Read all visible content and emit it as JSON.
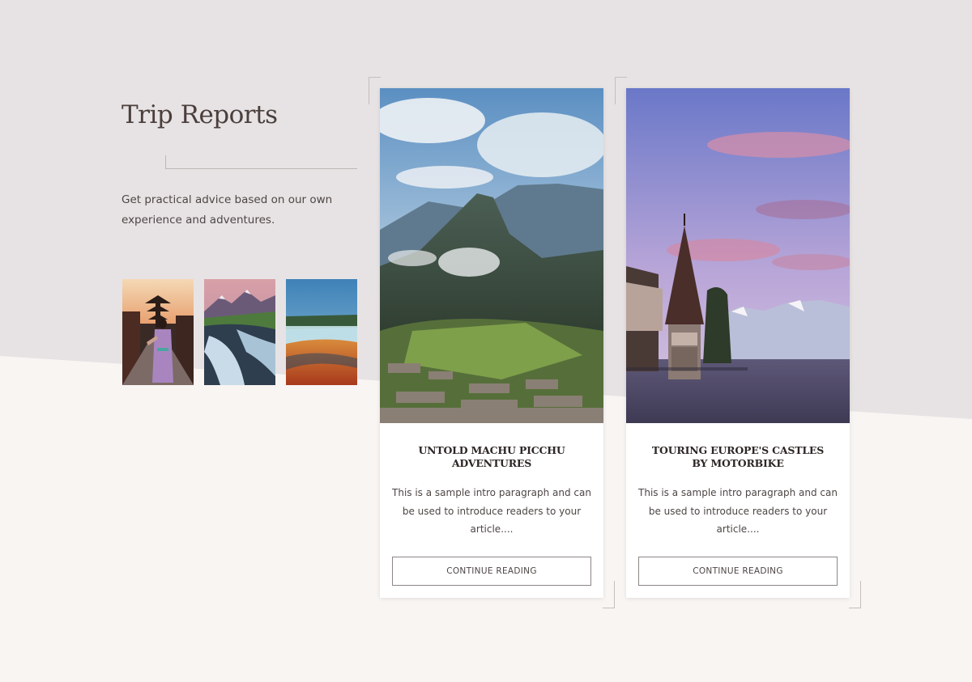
{
  "section": {
    "title": "Trip Reports",
    "intro": "Get practical advice based on our own experience and adventures."
  },
  "thumbnails": [
    {
      "icon": "kyoto-street-photo"
    },
    {
      "icon": "glacier-river-photo"
    },
    {
      "icon": "hot-spring-photo"
    }
  ],
  "cards": [
    {
      "title": "Untold Machu Picchu Adventures",
      "excerpt": "This is a sample intro paragraph and can be used to introduce readers to your article....",
      "button": "Continue Reading",
      "image_icon": "machu-picchu-photo"
    },
    {
      "title": "Touring Europe's Castles by Motorbike",
      "excerpt": "This is a sample intro paragraph and can be used to introduce readers to your article....",
      "button": "Continue Reading",
      "image_icon": "lakeside-castle-photo"
    }
  ],
  "colors": {
    "background_upper": "#e7e3e4",
    "background_lower": "#f8f5f3",
    "text": "#3f3a39",
    "card_bg": "#ffffff"
  }
}
